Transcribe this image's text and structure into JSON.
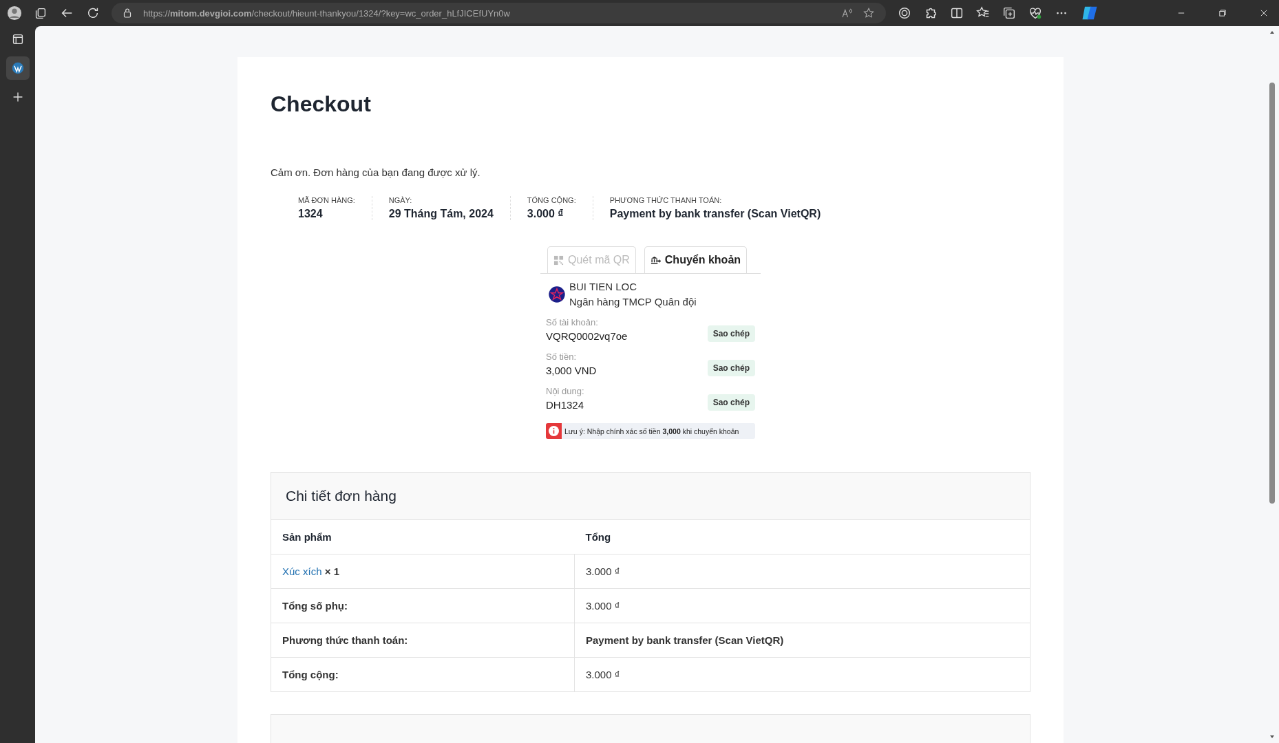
{
  "browser": {
    "url": "https://**mitom.devgioi.com**/checkout/hieunt-thankyou/1324/?key=wc_order_hLfJICEfUYn0w"
  },
  "page": {
    "title": "Checkout",
    "thank_you": "Cảm ơn. Đơn hàng của bạn đang được xử lý.",
    "overview": [
      {
        "label": "MÃ ĐƠN HÀNG:",
        "value": "1324"
      },
      {
        "label": "NGÀY:",
        "value": "29 Tháng Tám, 2024"
      },
      {
        "label": "TỔNG CỘNG:",
        "value": "3.000 ₫"
      },
      {
        "label": "PHƯƠNG THỨC THANH TOÁN:",
        "value": "Payment by bank transfer (Scan VietQR)"
      }
    ],
    "payment_tabs": [
      {
        "kind": "qr",
        "label": "Quét mã QR",
        "selected": false
      },
      {
        "kind": "bank",
        "label": "Chuyển khoản",
        "selected": true
      }
    ],
    "account": {
      "holder": "BUI TIEN LOC",
      "bank": "Ngân hàng TMCP Quân đội"
    },
    "fields": [
      {
        "label": "Số tài khoản:",
        "value": "VQRQ0002vq7oe",
        "button": "Sao chép"
      },
      {
        "label": "Số tiền:",
        "value": "3,000 VND",
        "button": "Sao chép"
      },
      {
        "label": "Nội dung:",
        "value": "DH1324",
        "button": "Sao chép"
      }
    ],
    "note": "Lưu ý: Nhập chính xác số tiền **3,000** khi chuyển khoản",
    "order_details": {
      "title": "Chi tiết đơn hàng",
      "columns": [
        "Sản phẩm",
        "Tổng"
      ],
      "rows": [
        {
          "kind": "product",
          "label": "Xúc xích",
          "qty": "× 1",
          "value": "3.000 ₫"
        },
        {
          "kind": "total",
          "label": "Tổng số phụ:",
          "value": "3.000 ₫"
        },
        {
          "kind": "total",
          "label": "Phương thức thanh toán:",
          "value": "Payment by bank transfer (Scan VietQR)"
        },
        {
          "kind": "total",
          "label": "Tổng cộng:",
          "value": "3.000 ₫"
        }
      ]
    }
  }
}
